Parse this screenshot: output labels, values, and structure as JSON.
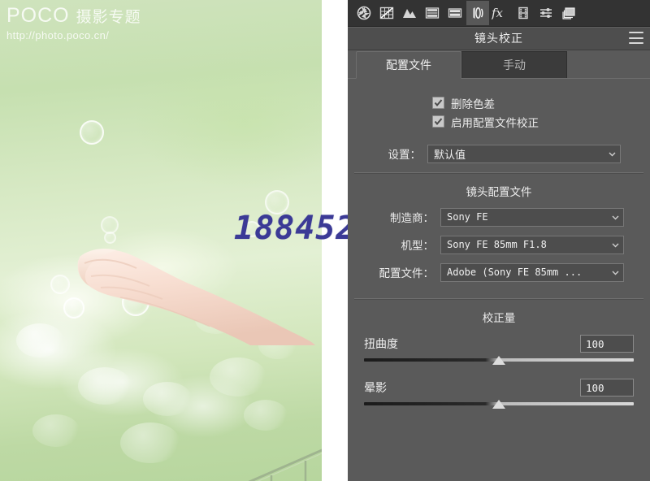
{
  "photo": {
    "watermark_brand": "POCO",
    "watermark_cn": "摄影专题",
    "watermark_url": "http://photo.poco.cn/",
    "overlay_number": "188452",
    "alt": "hand reaching out with soap bubbles over green bokeh grass"
  },
  "panel": {
    "title": "镜头校正",
    "menu_icon": "hamburger-menu-icon",
    "toolbar": [
      {
        "name": "basic-aperture-icon",
        "active": false
      },
      {
        "name": "tone-curve-icon",
        "active": false
      },
      {
        "name": "detail-icon",
        "active": false
      },
      {
        "name": "hsl-grayscale-icon",
        "active": false
      },
      {
        "name": "split-toning-icon",
        "active": false
      },
      {
        "name": "lens-correction-icon",
        "active": true
      },
      {
        "name": "effects-fx-icon",
        "active": false
      },
      {
        "name": "camera-calibration-icon",
        "active": false
      },
      {
        "name": "presets-icon",
        "active": false
      },
      {
        "name": "snapshots-icon",
        "active": false
      }
    ],
    "tabs": [
      {
        "label": "配置文件",
        "active": true
      },
      {
        "label": "手动",
        "active": false
      }
    ],
    "checkboxes": [
      {
        "label": "删除色差",
        "checked": true
      },
      {
        "label": "启用配置文件校正",
        "checked": true
      }
    ],
    "settings_field": {
      "label": "设置：",
      "value": "默认值"
    },
    "lens_profile": {
      "section_title": "镜头配置文件",
      "fields": [
        {
          "label": "制造商：",
          "value": "Sony FE"
        },
        {
          "label": "机型：",
          "value": "Sony FE 85mm F1.8"
        },
        {
          "label": "配置文件：",
          "value": "Adobe (Sony FE 85mm ..."
        }
      ]
    },
    "correction": {
      "section_title": "校正量",
      "sliders": [
        {
          "label": "扭曲度",
          "value": "100",
          "position_pct": 50
        },
        {
          "label": "晕影",
          "value": "100",
          "position_pct": 50
        }
      ]
    }
  }
}
